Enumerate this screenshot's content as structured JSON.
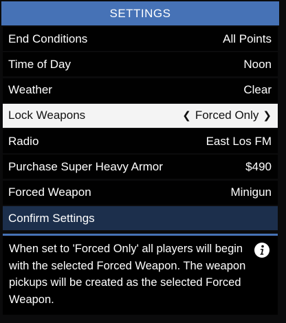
{
  "header": {
    "title": "SETTINGS"
  },
  "settings": [
    {
      "label": "End Conditions",
      "value": "All Points",
      "selected": false
    },
    {
      "label": "Time of Day",
      "value": "Noon",
      "selected": false
    },
    {
      "label": "Weather",
      "value": "Clear",
      "selected": false
    },
    {
      "label": "Lock Weapons",
      "value": "Forced Only",
      "selected": true
    },
    {
      "label": "Radio",
      "value": "East Los FM",
      "selected": false
    },
    {
      "label": "Purchase Super Heavy Armor",
      "value": "$490",
      "selected": false
    },
    {
      "label": "Forced Weapon",
      "value": "Minigun",
      "selected": false
    }
  ],
  "confirm": {
    "label": "Confirm Settings"
  },
  "description": {
    "text": "When set to 'Forced Only' all players will begin with the selected Forced Weapon. The weapon pickups will be created as the selected Forced Weapon.",
    "icon": "info-icon"
  },
  "colors": {
    "header": "#4672b6",
    "selected_row": "#f4f4f4",
    "confirm_row": "#1c2f4c"
  }
}
